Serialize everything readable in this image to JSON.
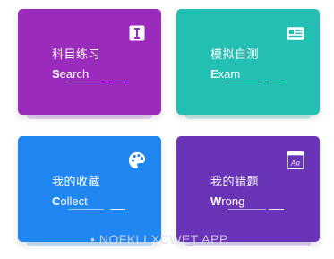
{
  "cards": [
    {
      "title": "科目练习",
      "sub_lead": "S",
      "sub_rest": "earch",
      "color": "#9a2bbd",
      "icon": "text-cursor-icon"
    },
    {
      "title": "模拟自测",
      "sub_lead": "E",
      "sub_rest": "xam",
      "color": "#22bfb2",
      "icon": "id-card-icon"
    },
    {
      "title": "我的收藏",
      "sub_lead": "C",
      "sub_rest": "ollect",
      "color": "#1f86f2",
      "icon": "palette-icon"
    },
    {
      "title": "我的错题",
      "sub_lead": "W",
      "sub_rest": "rong",
      "color": "#6a34b8",
      "icon": "font-aa-icon"
    }
  ],
  "watermark": "• NOFKLI XCWET APP",
  "icon_glyph_aa": "Aa"
}
